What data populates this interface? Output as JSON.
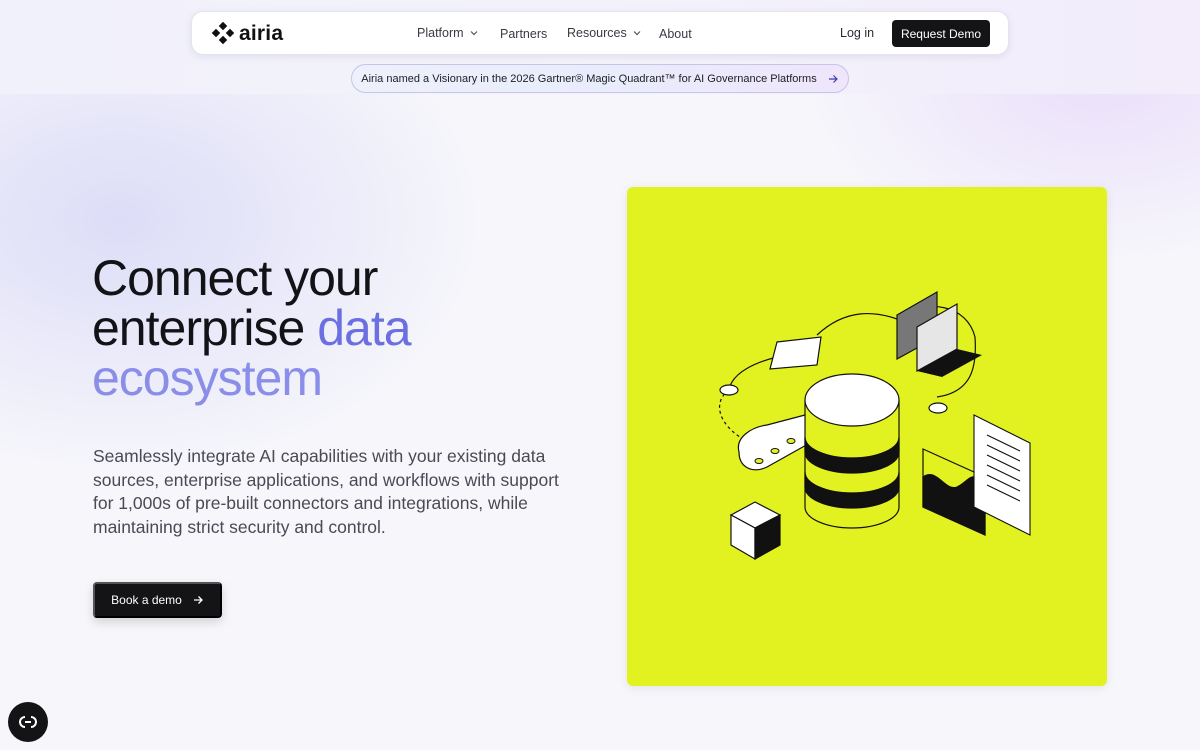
{
  "nav": {
    "logo_text": "airia",
    "items": [
      {
        "label": "Platform",
        "has_dropdown": true
      },
      {
        "label": "Partners",
        "has_dropdown": false
      },
      {
        "label": "Resources",
        "has_dropdown": true
      },
      {
        "label": "About",
        "has_dropdown": false
      }
    ],
    "login_label": "Log in",
    "cta_label": "Request Demo"
  },
  "announcement": {
    "text": "Airia named a Visionary in the 2026 Gartner® Magic Quadrant™ for AI Governance Platforms",
    "icon": "arrow-right-icon"
  },
  "hero": {
    "title_line1": "Connect your",
    "title_line2_plain": "enterprise ",
    "title_line2_accent": "data",
    "title_line3_accent": "ecosystem",
    "description": "Seamlessly integrate AI capabilities with your existing data sources, enterprise applications, and workflows with support for 1,000s of pre-built connectors and integrations, while maintaining strict security and control.",
    "cta_label": "Book a demo",
    "cta_icon": "arrow-right-icon"
  },
  "illustration": {
    "background": "#e2f220",
    "subject": "isometric-data-ecosystem-icon"
  },
  "widget": {
    "icon": "chat-bubble-icon"
  },
  "colors": {
    "accent": "#6c6fe0",
    "accent_light": "#8a8ee9",
    "dark_button": "#141416",
    "lime": "#e2f220"
  }
}
